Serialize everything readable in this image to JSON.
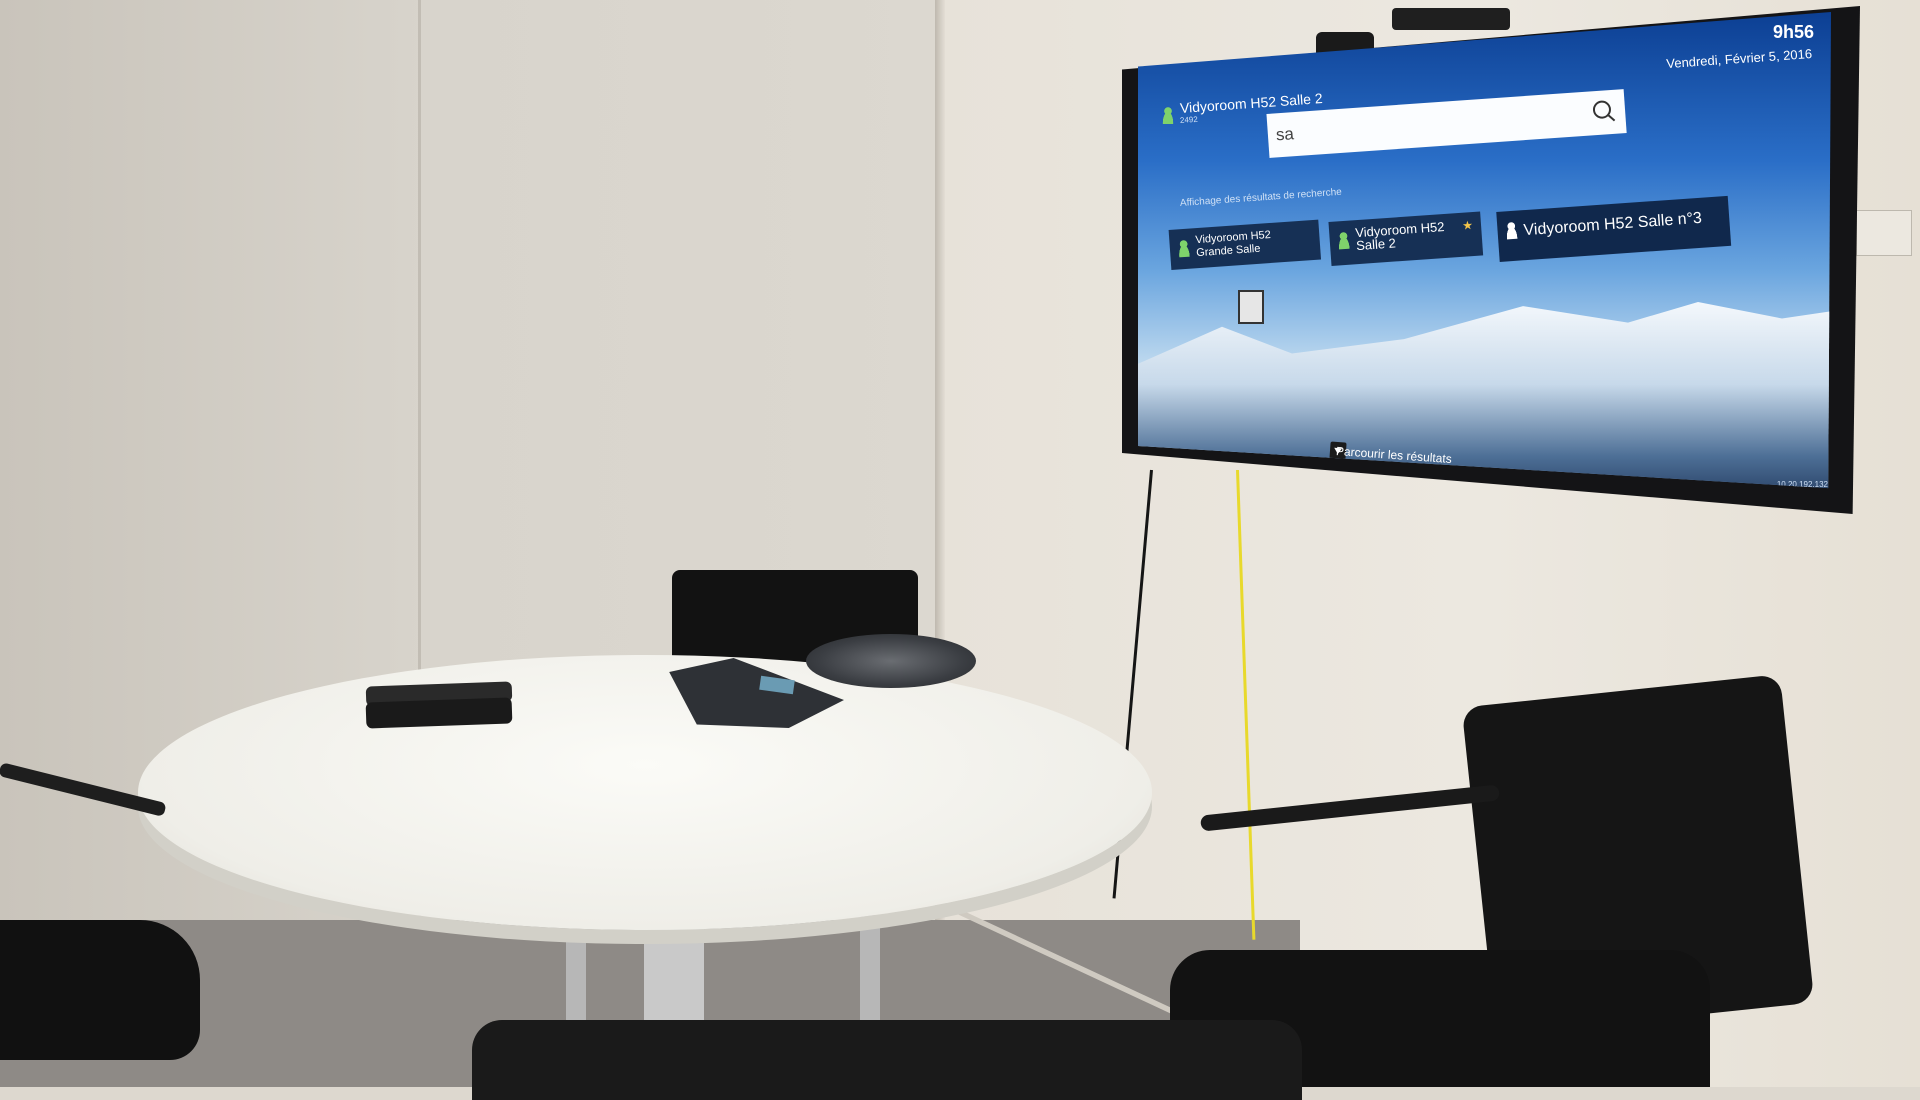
{
  "tv_screen": {
    "room_name": "Vidyoroom H52 Salle 2",
    "room_id": "2492",
    "time": "9h56",
    "date": "Vendredi, Février 5, 2016",
    "search": {
      "value": "sa"
    },
    "results_label": "Affichage des résultats de recherche",
    "results": [
      {
        "label": "Vidyoroom H52 Grande Salle",
        "icon": "person-icon",
        "favorite": false
      },
      {
        "label": "Vidyoroom H52 Salle 2",
        "icon": "person-icon",
        "favorite": true
      },
      {
        "label": "Vidyoroom H52 Salle n°3",
        "icon": "person-icon",
        "favorite": false
      }
    ],
    "browse_label": "Parcourir les résultats",
    "ip_address": "10.20.192.132"
  },
  "colors": {
    "screen_blue": "#2a6ec7",
    "tile_dark": "#163055",
    "presence_green": "#7fd36b",
    "favorite_star": "#f3c54a",
    "cable_yellow": "#e8d92c"
  }
}
